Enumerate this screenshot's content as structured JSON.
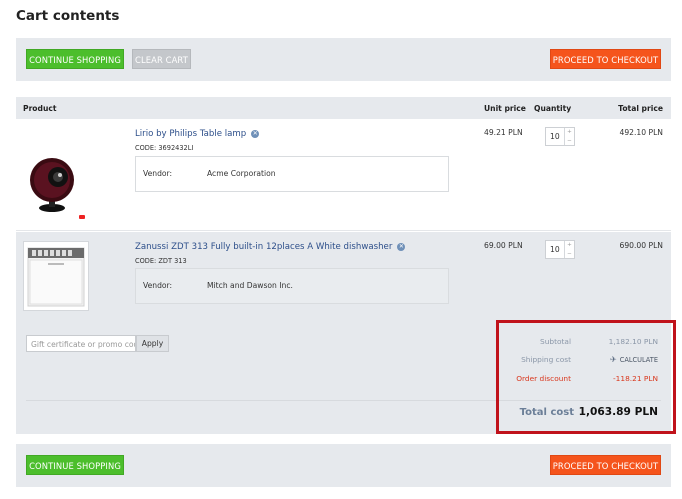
{
  "page": {
    "title": "Cart contents"
  },
  "buttons": {
    "continue_shopping": "CONTINUE SHOPPING",
    "clear_cart": "CLEAR CART",
    "proceed_checkout": "PROCEED TO CHECKOUT"
  },
  "table": {
    "headers": {
      "product": "Product",
      "unit_price": "Unit price",
      "quantity": "Quantity",
      "total_price": "Total price"
    },
    "vendor_label": "Vendor:",
    "rows": [
      {
        "name": "Lirio by Philips Table lamp",
        "code": "CODE: 3692432LI",
        "vendor": "Acme Corporation",
        "unit_price": "49.21 PLN",
        "quantity": "10",
        "total_price": "492.10 PLN"
      },
      {
        "name": "Zanussi ZDT 313 Fully built-in 12places A White dishwasher",
        "code": "CODE: ZDT 313",
        "vendor": "Mitch and Dawson Inc.",
        "unit_price": "69.00 PLN",
        "quantity": "10",
        "total_price": "690.00 PLN"
      }
    ]
  },
  "promo": {
    "placeholder": "Gift certificate or promo code",
    "apply_label": "Apply"
  },
  "summary": {
    "subtotal_label": "Subtotal",
    "subtotal_value": "1,182.10 PLN",
    "shipping_label": "Shipping cost",
    "shipping_action": "CALCULATE",
    "discount_label": "Order discount",
    "discount_value": "-118.21 PLN",
    "total_label": "Total cost",
    "total_value": "1,063.89 PLN"
  },
  "icons": {
    "remove": "remove-icon",
    "shipping": "plane-icon",
    "spinner_up": "chevron-up-icon",
    "spinner_down": "chevron-down-icon"
  },
  "colors": {
    "continue_button": "#4cbe2c",
    "clear_button": "#c4c7cb",
    "checkout_button": "#f5541c",
    "link": "#2d4f8a",
    "discount": "#d9381e",
    "highlight_box": "#c0121b"
  }
}
